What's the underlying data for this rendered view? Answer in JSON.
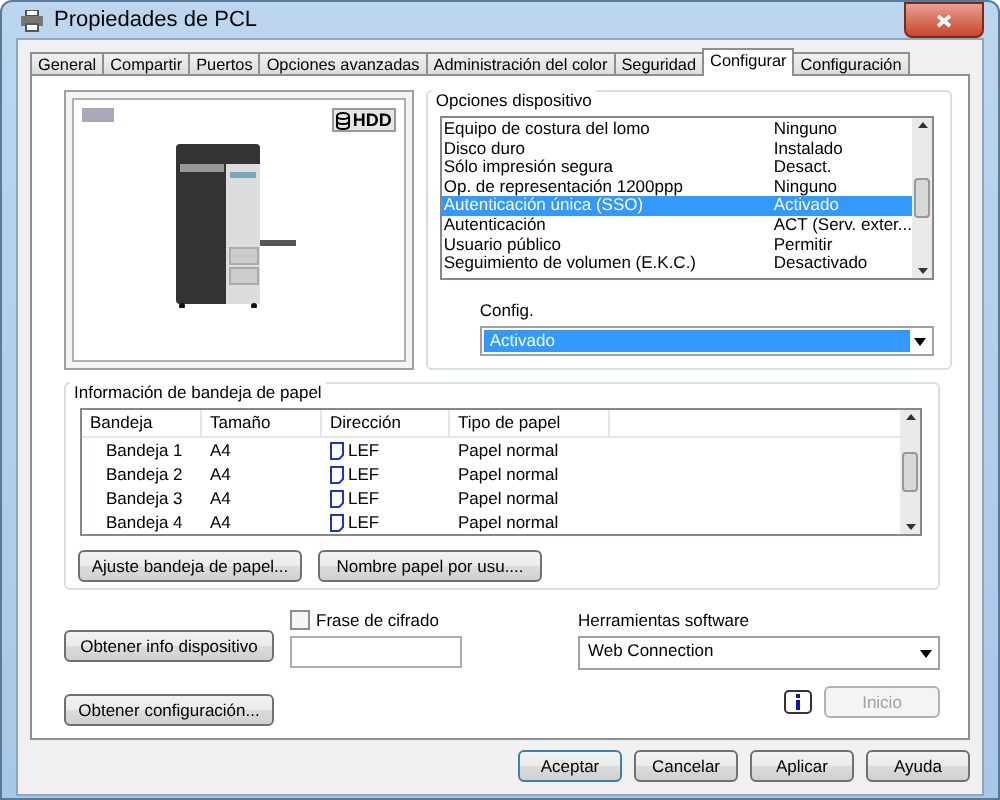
{
  "window": {
    "title": "Propiedades de PCL"
  },
  "tabs": [
    {
      "label": "General",
      "selected": false
    },
    {
      "label": "Compartir",
      "selected": false
    },
    {
      "label": "Puertos",
      "selected": false
    },
    {
      "label": "Opciones avanzadas",
      "selected": false
    },
    {
      "label": "Administración del color",
      "selected": false
    },
    {
      "label": "Seguridad",
      "selected": false
    },
    {
      "label": "Configurar",
      "selected": true
    },
    {
      "label": "Configuración",
      "selected": false
    }
  ],
  "preview": {
    "badge": "HDD"
  },
  "device_options": {
    "title": "Opciones dispositivo",
    "items": [
      {
        "name": "Equipo de costura del lomo",
        "value": "Ninguno",
        "selected": false
      },
      {
        "name": "Disco duro",
        "value": "Instalado",
        "selected": false
      },
      {
        "name": "Sólo impresión segura",
        "value": "Desact.",
        "selected": false
      },
      {
        "name": "Op. de representación 1200ppp",
        "value": "Ninguno",
        "selected": false
      },
      {
        "name": "Autenticación única (SSO)",
        "value": "Activado",
        "selected": true
      },
      {
        "name": "Autenticación",
        "value": "ACT (Serv. exter...",
        "selected": false
      },
      {
        "name": "Usuario público",
        "value": "Permitir",
        "selected": false
      },
      {
        "name": "Seguimiento de volumen (E.K.C.)",
        "value": "Desactivado",
        "selected": false
      }
    ],
    "config_label": "Config.",
    "config_value": "Activado"
  },
  "tray_info": {
    "title": "Información de bandeja de papel",
    "columns": [
      "Bandeja",
      "Tamaño",
      "Dirección",
      "Tipo de papel"
    ],
    "rows": [
      [
        "Bandeja 1",
        "A4",
        "LEF",
        "Papel normal"
      ],
      [
        "Bandeja 2",
        "A4",
        "LEF",
        "Papel normal"
      ],
      [
        "Bandeja 3",
        "A4",
        "LEF",
        "Papel normal"
      ],
      [
        "Bandeja 4",
        "A4",
        "LEF",
        "Papel normal"
      ]
    ],
    "buttons": [
      "Ajuste bandeja de papel...",
      "Nombre papel por usu...."
    ]
  },
  "get_info_button": "Obtener info dispositivo",
  "passphrase": {
    "label": "Frase de cifrado",
    "checked": false
  },
  "software_tools": {
    "label": "Herramientas software",
    "value": "Web Connection"
  },
  "get_config_button": "Obtener configuración...",
  "start_button": {
    "label": "Inicio",
    "disabled": true
  },
  "dialog_buttons": [
    {
      "label": "Aceptar",
      "default": true
    },
    {
      "label": "Cancelar",
      "default": false
    },
    {
      "label": "Aplicar",
      "default": false
    },
    {
      "label": "Ayuda",
      "default": false
    }
  ]
}
